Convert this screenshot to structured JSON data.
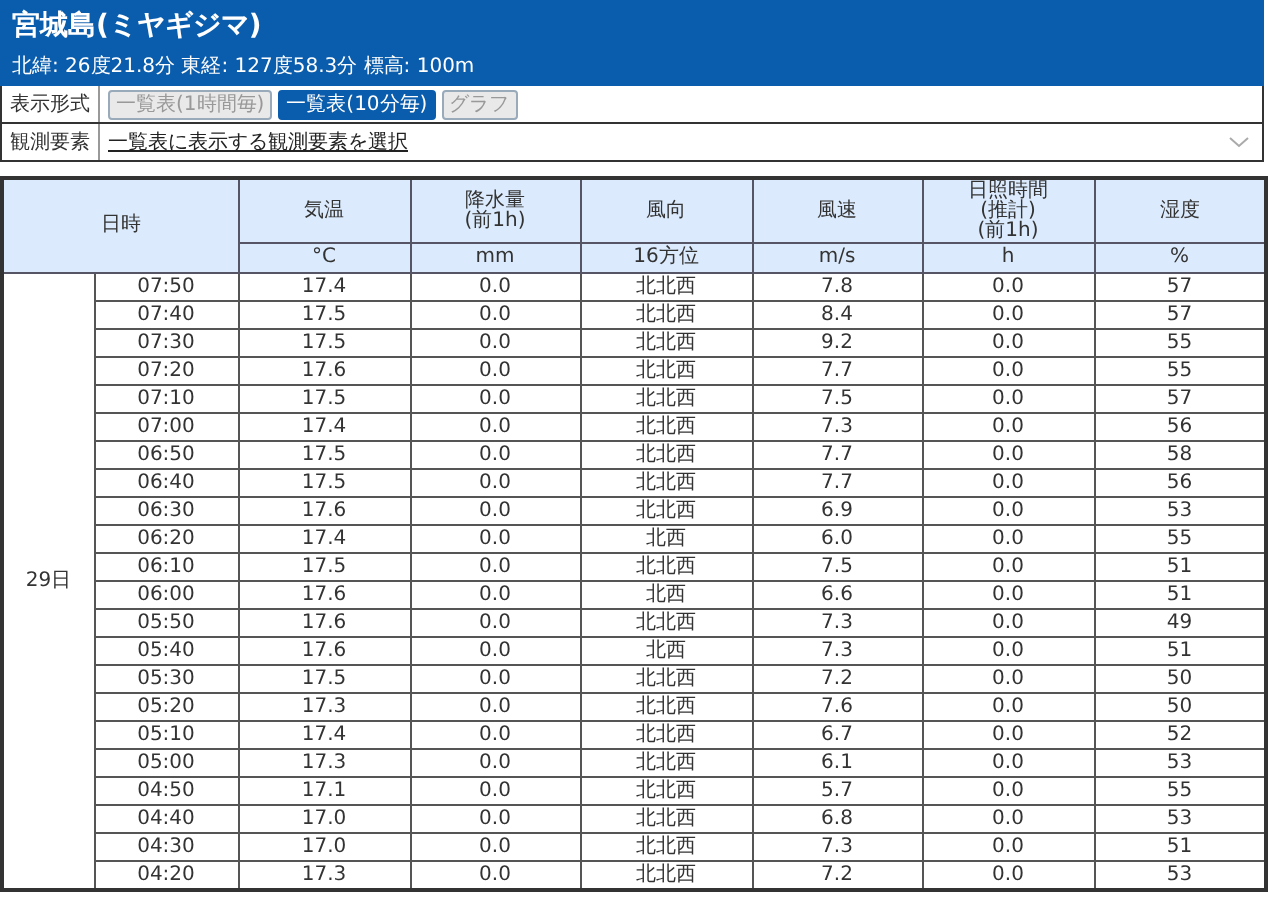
{
  "station": {
    "title": "宮城島(ミヤギジマ)",
    "info": "北緯: 26度21.8分 東経: 127度58.3分 標高: 100m"
  },
  "controls": [
    {
      "label": "表示形式",
      "kind": "buttons",
      "buttons": [
        {
          "label": "一覧表(1時間毎)",
          "selected": false
        },
        {
          "label": "一覧表(10分毎)",
          "selected": true
        },
        {
          "label": "グラフ",
          "selected": false
        }
      ]
    },
    {
      "label": "観測要素",
      "kind": "select",
      "value": "一覧表に表示する観測要素を選択"
    }
  ],
  "table": {
    "columns": [
      {
        "label": "日時"
      },
      {
        "label": "気温",
        "unit": "°C"
      },
      {
        "label": "降水量\n(前1h)",
        "unit": "mm"
      },
      {
        "label": "風向",
        "unit": "16方位"
      },
      {
        "label": "風速",
        "unit": "m/s"
      },
      {
        "label": "日照時間\n(推計)\n(前1h)",
        "unit": "h"
      },
      {
        "label": "湿度",
        "unit": "%"
      }
    ],
    "date": "29日",
    "rows": [
      [
        "07:50",
        "17.4",
        "0.0",
        "北北西",
        "7.8",
        "0.0",
        "57"
      ],
      [
        "07:40",
        "17.5",
        "0.0",
        "北北西",
        "8.4",
        "0.0",
        "57"
      ],
      [
        "07:30",
        "17.5",
        "0.0",
        "北北西",
        "9.2",
        "0.0",
        "55"
      ],
      [
        "07:20",
        "17.6",
        "0.0",
        "北北西",
        "7.7",
        "0.0",
        "55"
      ],
      [
        "07:10",
        "17.5",
        "0.0",
        "北北西",
        "7.5",
        "0.0",
        "57"
      ],
      [
        "07:00",
        "17.4",
        "0.0",
        "北北西",
        "7.3",
        "0.0",
        "56"
      ],
      [
        "06:50",
        "17.5",
        "0.0",
        "北北西",
        "7.7",
        "0.0",
        "58"
      ],
      [
        "06:40",
        "17.5",
        "0.0",
        "北北西",
        "7.7",
        "0.0",
        "56"
      ],
      [
        "06:30",
        "17.6",
        "0.0",
        "北北西",
        "6.9",
        "0.0",
        "53"
      ],
      [
        "06:20",
        "17.4",
        "0.0",
        "北西",
        "6.0",
        "0.0",
        "55"
      ],
      [
        "06:10",
        "17.5",
        "0.0",
        "北北西",
        "7.5",
        "0.0",
        "51"
      ],
      [
        "06:00",
        "17.6",
        "0.0",
        "北西",
        "6.6",
        "0.0",
        "51"
      ],
      [
        "05:50",
        "17.6",
        "0.0",
        "北北西",
        "7.3",
        "0.0",
        "49"
      ],
      [
        "05:40",
        "17.6",
        "0.0",
        "北西",
        "7.3",
        "0.0",
        "51"
      ],
      [
        "05:30",
        "17.5",
        "0.0",
        "北北西",
        "7.2",
        "0.0",
        "50"
      ],
      [
        "05:20",
        "17.3",
        "0.0",
        "北北西",
        "7.6",
        "0.0",
        "50"
      ],
      [
        "05:10",
        "17.4",
        "0.0",
        "北北西",
        "6.7",
        "0.0",
        "52"
      ],
      [
        "05:00",
        "17.3",
        "0.0",
        "北北西",
        "6.1",
        "0.0",
        "53"
      ],
      [
        "04:50",
        "17.1",
        "0.0",
        "北北西",
        "5.7",
        "0.0",
        "55"
      ],
      [
        "04:40",
        "17.0",
        "0.0",
        "北北西",
        "6.8",
        "0.0",
        "53"
      ],
      [
        "04:30",
        "17.0",
        "0.0",
        "北北西",
        "7.3",
        "0.0",
        "51"
      ],
      [
        "04:20",
        "17.3",
        "0.0",
        "北北西",
        "7.2",
        "0.0",
        "53"
      ]
    ]
  }
}
